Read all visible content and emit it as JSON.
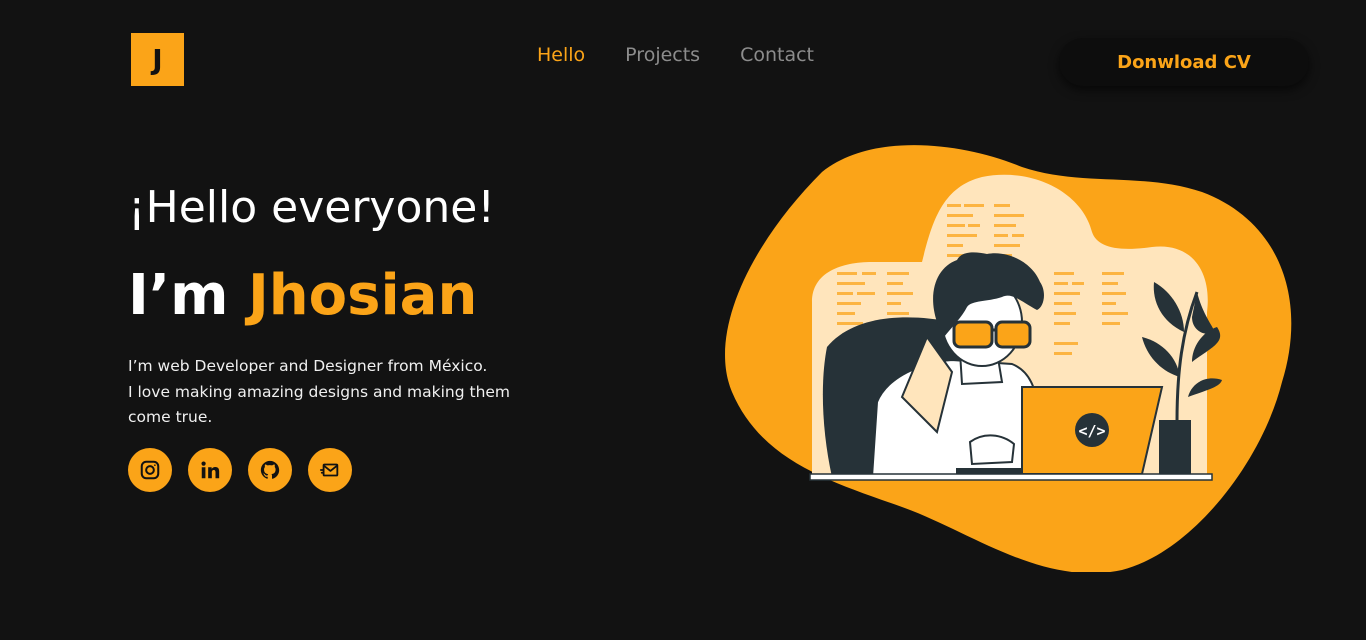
{
  "logo": {
    "letter": "J"
  },
  "nav": {
    "items": [
      {
        "label": "Hello",
        "active": true
      },
      {
        "label": "Projects",
        "active": false
      },
      {
        "label": "Contact",
        "active": false
      }
    ]
  },
  "header": {
    "cv_button": "Donwload CV"
  },
  "hero": {
    "greeting": "¡Hello everyone!",
    "im": "I’m ",
    "name": "Jhosian",
    "bio_lines": [
      "I’m web Developer and Designer from México.",
      "I love making amazing designs and making them",
      "come true."
    ]
  },
  "socials": [
    {
      "icon": "instagram-icon"
    },
    {
      "icon": "linkedin-icon"
    },
    {
      "icon": "github-icon"
    },
    {
      "icon": "mail-icon"
    }
  ],
  "illustration": {
    "code_tag": "</>"
  },
  "colors": {
    "accent": "#FBA418",
    "background": "#121212",
    "dark": "#263238"
  }
}
